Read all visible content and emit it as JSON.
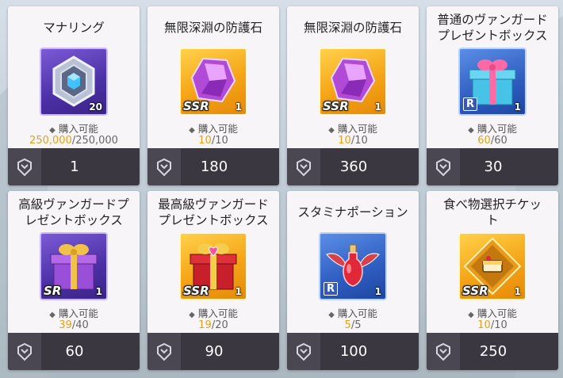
{
  "shop": {
    "items": [
      {
        "name": "マナリング",
        "bg": "purple",
        "rarity": "",
        "qty": "20",
        "available": "購入可能",
        "stock_current": "250,000",
        "stock_max": "/250,000",
        "price": "1",
        "icon": "mana-ring-icon"
      },
      {
        "name": "無限深淵の防護石",
        "bg": "gold",
        "rarity": "SSR",
        "qty": "1",
        "available": "購入可能",
        "stock_current": "10",
        "stock_max": "/10",
        "price": "180",
        "icon": "protection-stone-icon"
      },
      {
        "name": "無限深淵の防護石",
        "bg": "gold",
        "rarity": "SSR",
        "qty": "1",
        "available": "購入可能",
        "stock_current": "10",
        "stock_max": "/10",
        "price": "360",
        "icon": "protection-stone-icon"
      },
      {
        "name": "普通のヴァンガード\nプレゼントボックス",
        "bg": "blue",
        "rarity": "R",
        "qty": "1",
        "available": "購入可能",
        "stock_current": "60",
        "stock_max": "/60",
        "price": "30",
        "icon": "gift-box-icon"
      },
      {
        "name": "高級ヴァンガードプ\nレゼントボックス",
        "bg": "purple",
        "rarity": "SR",
        "qty": "1",
        "available": "購入可能",
        "stock_current": "39",
        "stock_max": "/40",
        "price": "60",
        "icon": "gift-box-icon"
      },
      {
        "name": "最高級ヴァンガード\nプレゼントボックス",
        "bg": "gold",
        "rarity": "SSR",
        "qty": "1",
        "available": "購入可能",
        "stock_current": "19",
        "stock_max": "/20",
        "price": "90",
        "icon": "gift-box-icon"
      },
      {
        "name": "スタミナポーション",
        "bg": "blue",
        "rarity": "R",
        "qty": "1",
        "available": "購入可能",
        "stock_current": "5",
        "stock_max": "/5",
        "price": "100",
        "icon": "stamina-potion-icon"
      },
      {
        "name": "食べ物選択チケッ\nト",
        "bg": "gold",
        "rarity": "SSR",
        "qty": "1",
        "available": "購入可能",
        "stock_current": "10",
        "stock_max": "/10",
        "price": "250",
        "icon": "food-ticket-icon"
      }
    ]
  },
  "colors": {
    "accent": "#e2a21b",
    "price_bar": "#3a3740"
  }
}
